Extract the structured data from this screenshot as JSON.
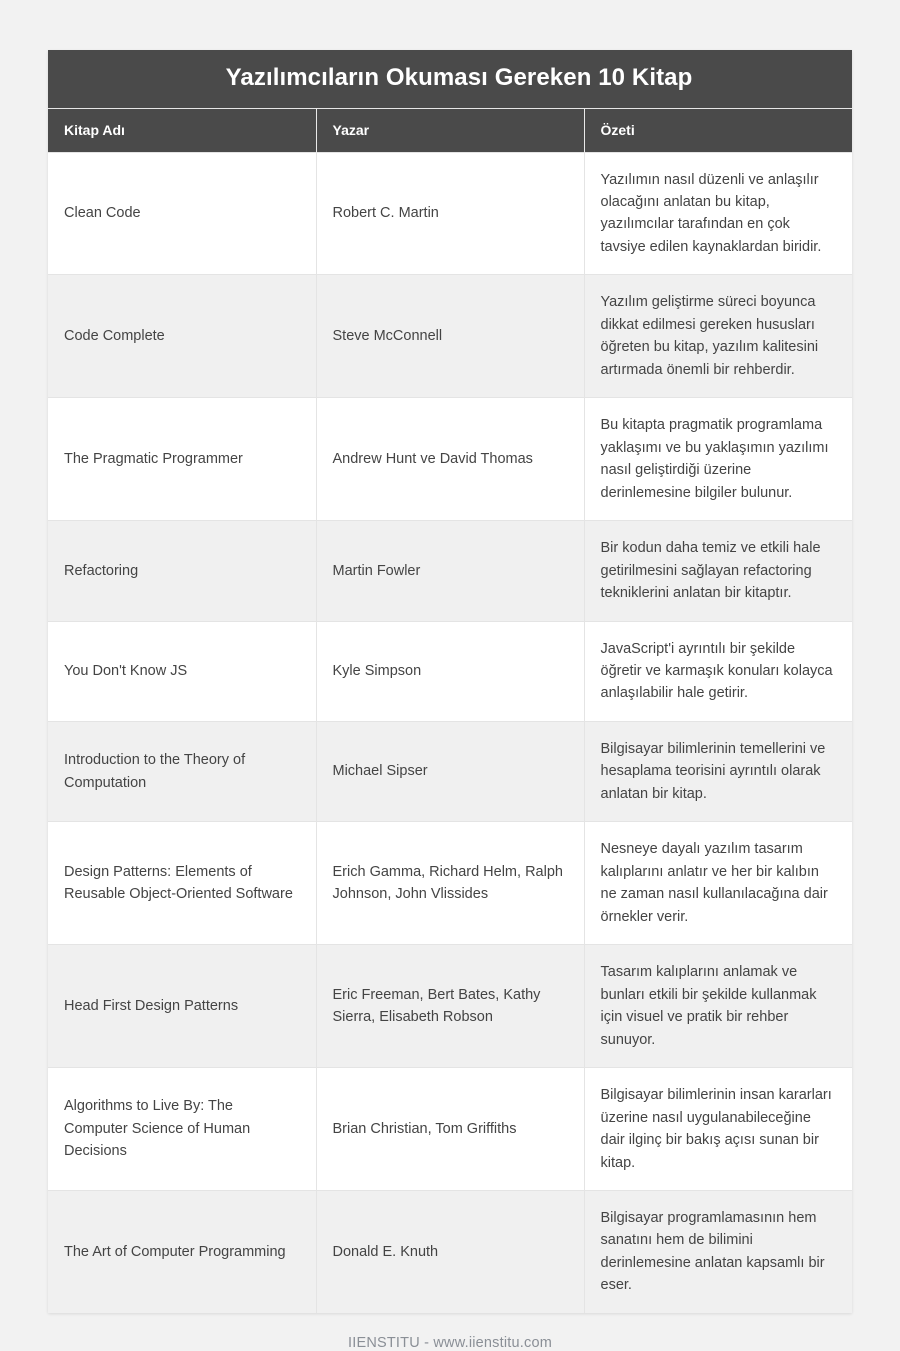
{
  "page": {
    "background_color": "#f2f2f2"
  },
  "header": {
    "title": "Yazılımcıların Okuması Gereken 10 Kitap",
    "background_color": "#4a4a4a",
    "text_color": "#ffffff"
  },
  "table": {
    "columns": [
      {
        "key": "title",
        "label": "Kitap Adı"
      },
      {
        "key": "author",
        "label": "Yazar"
      },
      {
        "key": "summary",
        "label": "Özeti"
      }
    ],
    "row_colors": {
      "odd": "#ffffff",
      "even": "#f0f0f0"
    },
    "rows": [
      {
        "title": "Clean Code",
        "author": "Robert C. Martin",
        "summary": "Yazılımın nasıl düzenli ve anlaşılır olacağını anlatan bu kitap, yazılımcılar tarafından en çok tavsiye edilen kaynaklardan biridir."
      },
      {
        "title": "Code Complete",
        "author": "Steve McConnell",
        "summary": "Yazılım geliştirme süreci boyunca dikkat edilmesi gereken hususları öğreten bu kitap, yazılım kalitesini artırmada önemli bir rehberdir."
      },
      {
        "title": "The Pragmatic Programmer",
        "author": "Andrew Hunt ve David Thomas",
        "summary": "Bu kitapta pragmatik programlama yaklaşımı ve bu yaklaşımın yazılımı nasıl geliştirdiği üzerine derinlemesine bilgiler bulunur."
      },
      {
        "title": "Refactoring",
        "author": "Martin Fowler",
        "summary": "Bir kodun daha temiz ve etkili hale getirilmesini sağlayan refactoring tekniklerini anlatan bir kitaptır."
      },
      {
        "title": "You Don't Know JS",
        "author": "Kyle Simpson",
        "summary": "JavaScript'i ayrıntılı bir şekilde öğretir ve karmaşık konuları kolayca anlaşılabilir hale getirir."
      },
      {
        "title": "Introduction to the Theory of Computation",
        "author": "Michael Sipser",
        "summary": "Bilgisayar bilimlerinin temellerini ve hesaplama teorisini ayrıntılı olarak anlatan bir kitap."
      },
      {
        "title": "Design Patterns: Elements of Reusable Object-Oriented Software",
        "author": "Erich Gamma, Richard Helm, Ralph Johnson, John Vlissides",
        "summary": "Nesneye dayalı yazılım tasarım kalıplarını anlatır ve her bir kalıbın ne zaman nasıl kullanılacağına dair örnekler verir."
      },
      {
        "title": "Head First Design Patterns",
        "author": "Eric Freeman, Bert Bates, Kathy Sierra, Elisabeth Robson",
        "summary": "Tasarım kalıplarını anlamak ve bunları etkili bir şekilde kullanmak için visuel ve pratik bir rehber sunuyor."
      },
      {
        "title": "Algorithms to Live By: The Computer Science of Human Decisions",
        "author": "Brian Christian, Tom Griffiths",
        "summary": "Bilgisayar bilimlerinin insan kararları üzerine nasıl uygulanabileceğine dair ilginç bir bakış açısı sunan bir kitap."
      },
      {
        "title": "The Art of Computer Programming",
        "author": "Donald E. Knuth",
        "summary": "Bilgisayar programlamasının hem sanatını hem de bilimini derinlemesine anlatan kapsamlı bir eser."
      }
    ]
  },
  "footer": {
    "text": "IIENSTITU - www.iienstitu.com"
  }
}
